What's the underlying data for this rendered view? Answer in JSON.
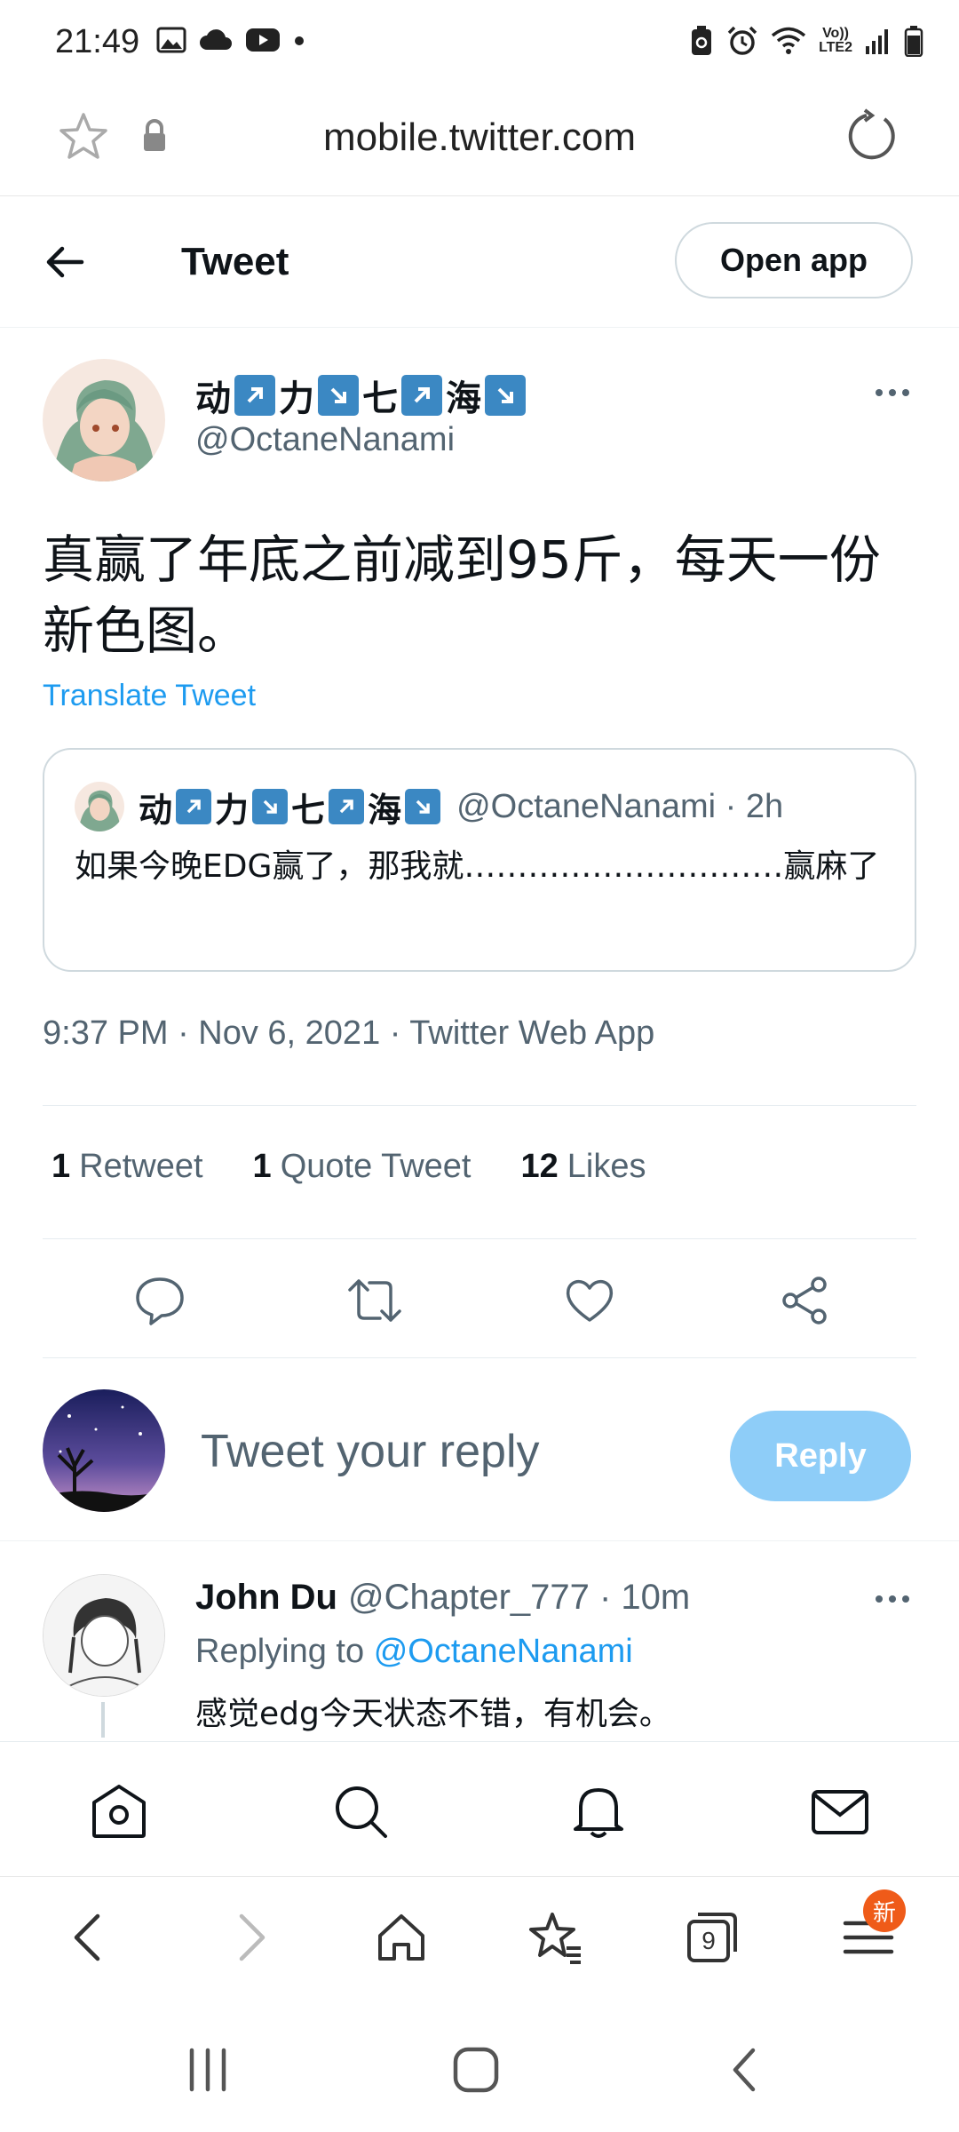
{
  "status_bar": {
    "time": "21:49",
    "volte": "Vo))",
    "lte": "LTE2"
  },
  "browser": {
    "url": "mobile.twitter.com"
  },
  "header": {
    "title": "Tweet",
    "open_app_label": "Open app"
  },
  "tweet": {
    "name_parts": [
      "动",
      "力",
      "七",
      "海"
    ],
    "handle": "@OctaneNanami",
    "text": "真赢了年底之前减到95斤，每天一份新色图。",
    "translate_label": "Translate Tweet",
    "quote": {
      "handle_time": "@OctaneNanami · 2h",
      "text": "如果今晚EDG赢了，那我就…………………………赢麻了"
    },
    "meta": "9:37 PM · Nov 6, 2021 · Twitter Web App",
    "stats": {
      "retweets_count": "1",
      "retweets_label": "Retweet",
      "quotes_count": "1",
      "quotes_label": "Quote Tweet",
      "likes_count": "12",
      "likes_label": "Likes"
    }
  },
  "reply_composer": {
    "placeholder": "Tweet your reply",
    "button_label": "Reply"
  },
  "reply": {
    "name": "John Du",
    "handle_time": "@Chapter_777 · 10m",
    "replying_prefix": "Replying to",
    "replying_to": "@OctaneNanami",
    "text": "感觉edg今天状态不错，有机会。"
  },
  "browser_toolbar": {
    "tabs_count": "9",
    "badge": "新"
  },
  "colors": {
    "accent": "#1d9bf0",
    "reply_button": "#8ecdf8",
    "badge": "#ef5b19",
    "emoji_box": "#3b88c3"
  }
}
